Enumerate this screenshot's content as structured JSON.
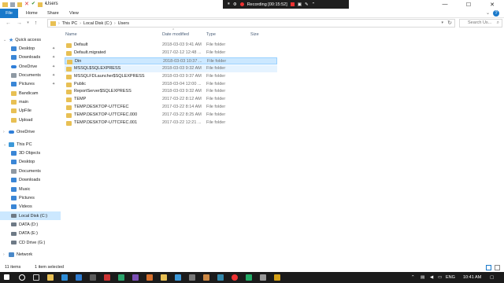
{
  "window": {
    "title": "Users",
    "controls": {
      "minimize": "—",
      "maximize": "☐",
      "close": "✕"
    }
  },
  "recorder": {
    "label": "Recording [00:15:52]"
  },
  "ribbon": {
    "tabs": [
      "File",
      "Home",
      "Share",
      "View"
    ],
    "help": "?"
  },
  "address": {
    "crumbs": [
      "This PC",
      "Local Disk (C:)",
      "Users"
    ],
    "search_placeholder": "Search Us..."
  },
  "nav": {
    "quick_access": "Quick access",
    "quick_items": [
      "Desktop",
      "Downloads",
      "OneDrive",
      "Documents",
      "Pictures",
      "Bandicam",
      "main",
      "UpFile",
      "Upload"
    ],
    "onedrive": "OneDrive",
    "this_pc": "This PC",
    "pc_items": [
      "3D Objects",
      "Desktop",
      "Documents",
      "Downloads",
      "Music",
      "Pictures",
      "Videos",
      "Local Disk (C:)",
      "DATA (D:)",
      "DATA (E:)",
      "CD Drive (G:)"
    ],
    "network": "Network"
  },
  "columns": {
    "name": "Name",
    "date": "Date modified",
    "type": "Type",
    "size": "Size"
  },
  "files": [
    {
      "name": "Default",
      "date": "2018-03-03 9:41 AM",
      "type": "File folder"
    },
    {
      "name": "Default.migrated",
      "date": "2017-02-12 12:48 ...",
      "type": "File folder"
    },
    {
      "name": "Din",
      "date": "2018-03-03 10:37 ...",
      "type": "File folder"
    },
    {
      "name": "MSSQL$SQLEXPRESS",
      "date": "2018-03-03 9:32 AM",
      "type": "File folder"
    },
    {
      "name": "MSSQLFDLauncher$SQLEXPRESS",
      "date": "2018-03-03 9:37 AM",
      "type": "File folder"
    },
    {
      "name": "Public",
      "date": "2018-03-04 12:00 ...",
      "type": "File folder"
    },
    {
      "name": "ReportServer$SQLEXPRESS",
      "date": "2018-03-03 9:32 AM",
      "type": "File folder"
    },
    {
      "name": "TEMP",
      "date": "2017-03-22 8:12 AM",
      "type": "File folder"
    },
    {
      "name": "TEMP.DESKTOP-U7TCFEC",
      "date": "2017-03-22 8:14 AM",
      "type": "File folder"
    },
    {
      "name": "TEMP.DESKTOP-U7TCFEC.000",
      "date": "2017-03-22 8:25 AM",
      "type": "File folder"
    },
    {
      "name": "TEMP.DESKTOP-U7TCFEC.001",
      "date": "2017-03-22 12:21 ...",
      "type": "File folder"
    }
  ],
  "status": {
    "count": "11 items",
    "selection": "1 item selected"
  },
  "taskbar": {
    "lang": "ENG",
    "time": "10:41 AM"
  }
}
